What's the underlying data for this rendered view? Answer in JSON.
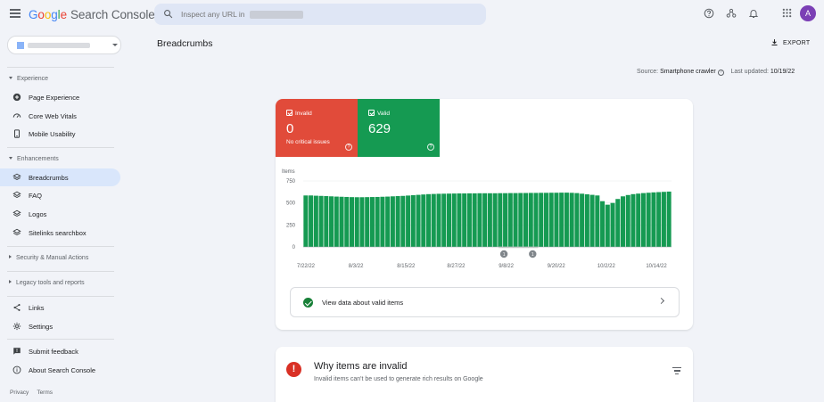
{
  "app": {
    "logo_google": [
      "G",
      "o",
      "o",
      "g",
      "l",
      "e"
    ],
    "logo_product": "Search Console"
  },
  "search": {
    "placeholder": "Inspect any URL in"
  },
  "header_icons": [
    "help-icon",
    "users-settings-icon",
    "bell-icon",
    "apps-grid-icon"
  ],
  "user": {
    "avatar_letter": "A",
    "avatar_color": "#7b3fb5"
  },
  "sidebar": {
    "sections": [
      {
        "label": "Experience",
        "expanded": true,
        "items": [
          {
            "label": "Page Experience",
            "icon": "plus-circle-icon"
          },
          {
            "label": "Core Web Vitals",
            "icon": "gauge-icon"
          },
          {
            "label": "Mobile Usability",
            "icon": "phone-icon"
          }
        ]
      },
      {
        "label": "Enhancements",
        "expanded": true,
        "items": [
          {
            "label": "Breadcrumbs",
            "icon": "layers-icon",
            "active": true
          },
          {
            "label": "FAQ",
            "icon": "layers-icon"
          },
          {
            "label": "Logos",
            "icon": "layers-icon"
          },
          {
            "label": "Sitelinks searchbox",
            "icon": "layers-icon"
          }
        ]
      },
      {
        "label": "Security & Manual Actions",
        "expanded": false,
        "items": []
      },
      {
        "label": "Legacy tools and reports",
        "expanded": false,
        "items": []
      }
    ],
    "bottom_items": [
      {
        "label": "Links",
        "icon": "share-icon"
      },
      {
        "label": "Settings",
        "icon": "gear-icon"
      },
      {
        "label": "Submit feedback",
        "icon": "feedback-icon"
      },
      {
        "label": "About Search Console",
        "icon": "info-icon"
      }
    ],
    "footer": [
      "Privacy",
      "Terms"
    ]
  },
  "page": {
    "title": "Breadcrumbs",
    "export_label": "EXPORT",
    "source_label": "Source:",
    "source_value": "Smartphone crawler",
    "updated_label": "Last updated:",
    "updated_value": "10/19/22"
  },
  "summary": {
    "invalid": {
      "label": "Invalid",
      "count": "0",
      "note": "No critical issues",
      "color": "#e14b3a"
    },
    "valid": {
      "label": "Valid",
      "count": "629",
      "color": "#159a52"
    }
  },
  "chart_data": {
    "type": "bar",
    "ylabel": "Items",
    "ylim": [
      0,
      750
    ],
    "yticks": [
      0,
      250,
      500,
      750
    ],
    "xtick_labels": [
      "7/22/22",
      "8/3/22",
      "8/15/22",
      "8/27/22",
      "9/8/22",
      "9/20/22",
      "10/2/22",
      "10/14/22"
    ],
    "annotations": [
      "1",
      "1"
    ],
    "color": "#159a52",
    "series": [
      {
        "values": [
          585,
          585,
          582,
          580,
          578,
          575,
          572,
          570,
          568,
          566,
          565,
          565,
          566,
          567,
          568,
          570,
          572,
          575,
          578,
          580,
          584,
          588,
          592,
          596,
          600,
          602,
          604,
          605,
          606,
          607,
          608,
          608,
          609,
          609,
          610,
          610,
          610,
          610,
          611,
          611,
          612,
          612,
          613,
          613,
          614,
          614,
          615,
          615,
          616,
          616,
          617,
          617,
          615,
          612,
          605,
          598,
          592,
          585,
          520,
          480,
          500,
          545,
          575,
          590,
          600,
          606,
          612,
          616,
          620,
          623,
          626,
          629
        ]
      }
    ]
  },
  "valid_link": {
    "label": "View data about valid items"
  },
  "invalid_section": {
    "title": "Why items are invalid",
    "description": "Invalid items can't be used to generate rich results on Google"
  }
}
